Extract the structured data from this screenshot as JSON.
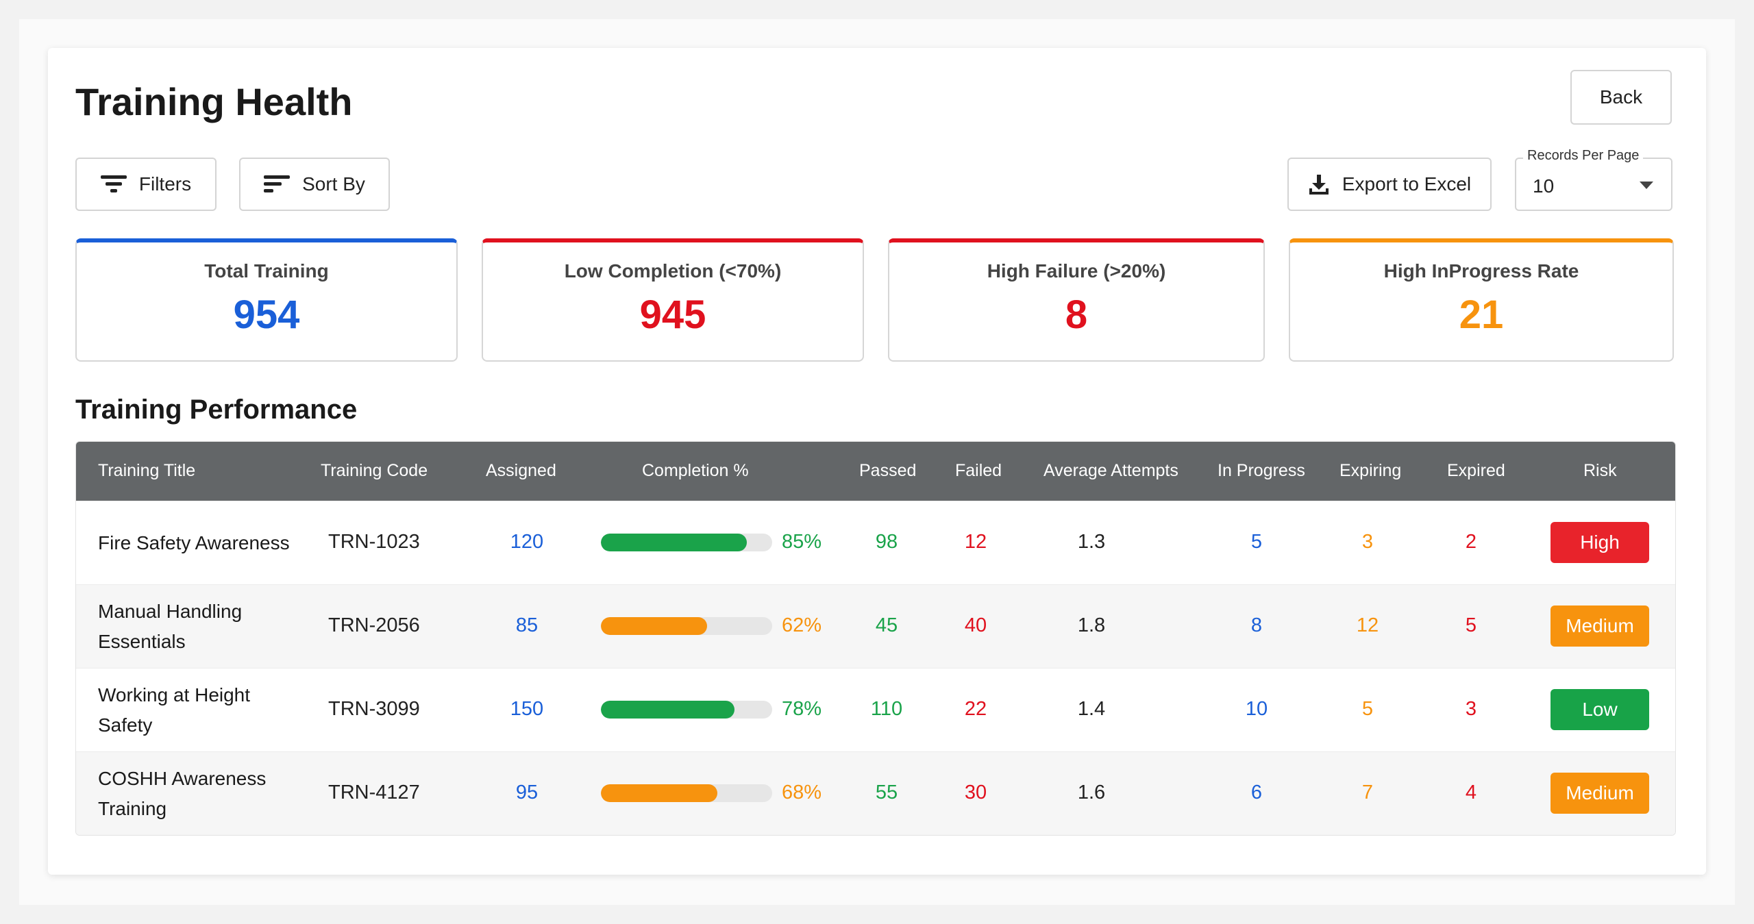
{
  "page": {
    "title": "Training Health",
    "back_label": "Back",
    "filters_label": "Filters",
    "sort_label": "Sort By",
    "export_label": "Export to Excel",
    "records_per_page_label": "Records Per Page",
    "records_per_page_value": "10"
  },
  "stats": [
    {
      "label": "Total Training",
      "value": "954",
      "color": "#1a5fd8"
    },
    {
      "label": "Low Completion (<70%)",
      "value": "945",
      "color": "#e0111e"
    },
    {
      "label": "High Failure (>20%)",
      "value": "8",
      "color": "#e0111e"
    },
    {
      "label": "High InProgress Rate",
      "value": "21",
      "color": "#f7930e"
    }
  ],
  "table": {
    "section_title": "Training Performance",
    "headers": [
      "Training Title",
      "Training Code",
      "Assigned",
      "Completion %",
      "Passed",
      "Failed",
      "Average Attempts",
      "In Progress",
      "Expiring",
      "Expired",
      "Risk"
    ],
    "rows": [
      {
        "title_line1": "Fire Safety Awareness",
        "title_line2": "",
        "code": "TRN-1023",
        "assigned": "120",
        "completion": "85%",
        "completion_value": 0.85,
        "completion_color": "#1aa34a",
        "passed": "98",
        "failed": "12",
        "avg_attempts": "1.3",
        "in_progress": "5",
        "expiring": "3",
        "expired": "2",
        "risk": "High",
        "risk_color": "#e8232b"
      },
      {
        "title_line1": "Manual Handling",
        "title_line2": "Essentials",
        "code": "TRN-2056",
        "assigned": "85",
        "completion": "62%",
        "completion_value": 0.62,
        "completion_color": "#f7930e",
        "passed": "45",
        "failed": "40",
        "avg_attempts": "1.8",
        "in_progress": "8",
        "expiring": "12",
        "expired": "5",
        "risk": "Medium",
        "risk_color": "#f7930e"
      },
      {
        "title_line1": "Working at Height",
        "title_line2": "Safety",
        "code": "TRN-3099",
        "assigned": "150",
        "completion": "78%",
        "completion_value": 0.78,
        "completion_color": "#1aa34a",
        "passed": "110",
        "failed": "22",
        "avg_attempts": "1.4",
        "in_progress": "10",
        "expiring": "5",
        "expired": "3",
        "risk": "Low",
        "risk_color": "#18a348"
      },
      {
        "title_line1": "COSHH Awareness",
        "title_line2": "Training",
        "code": "TRN-4127",
        "assigned": "95",
        "completion": "68%",
        "completion_value": 0.68,
        "completion_color": "#f7930e",
        "passed": "55",
        "failed": "30",
        "avg_attempts": "1.6",
        "in_progress": "6",
        "expiring": "7",
        "expired": "4",
        "risk": "Medium",
        "risk_color": "#f7930e"
      }
    ]
  },
  "icons": {
    "filters": "filter-icon",
    "sort": "sort-icon",
    "export": "download-icon",
    "dropdown": "caret-down-icon"
  }
}
